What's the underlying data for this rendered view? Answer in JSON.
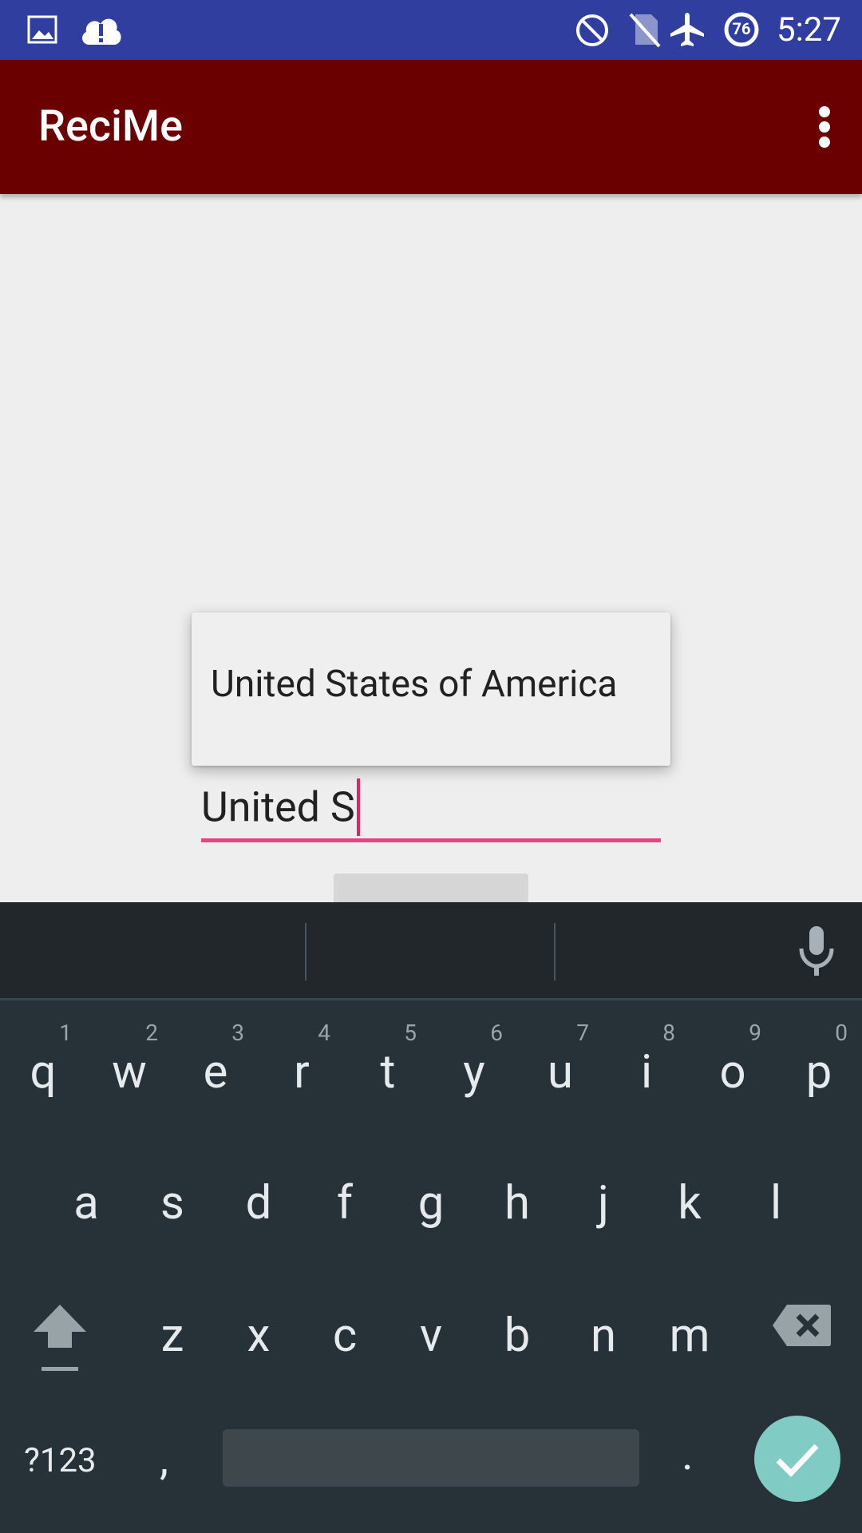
{
  "status_bar": {
    "time": "5:27",
    "icons": [
      "image-icon",
      "cloud-alert-icon",
      "do-not-disturb-icon",
      "no-sim-icon",
      "airplane-mode-icon",
      "battery-icon"
    ],
    "battery_level": "76"
  },
  "app_bar": {
    "title": "ReciMe",
    "menu_icon": "more-vert-icon"
  },
  "autocomplete": {
    "suggestions": [
      "United States of America"
    ]
  },
  "input": {
    "value": "United S"
  },
  "keyboard": {
    "row1": [
      {
        "key": "q",
        "hint": "1"
      },
      {
        "key": "w",
        "hint": "2"
      },
      {
        "key": "e",
        "hint": "3"
      },
      {
        "key": "r",
        "hint": "4"
      },
      {
        "key": "t",
        "hint": "5"
      },
      {
        "key": "y",
        "hint": "6"
      },
      {
        "key": "u",
        "hint": "7"
      },
      {
        "key": "i",
        "hint": "8"
      },
      {
        "key": "o",
        "hint": "9"
      },
      {
        "key": "p",
        "hint": "0"
      }
    ],
    "row2": [
      "a",
      "s",
      "d",
      "f",
      "g",
      "h",
      "j",
      "k",
      "l"
    ],
    "row3": [
      "z",
      "x",
      "c",
      "v",
      "b",
      "n",
      "m"
    ],
    "symbols_label": "?123",
    "comma": ",",
    "period": ".",
    "colors": {
      "background": "#263238",
      "enter": "#80cbc4",
      "caret": "#e91e63"
    }
  }
}
